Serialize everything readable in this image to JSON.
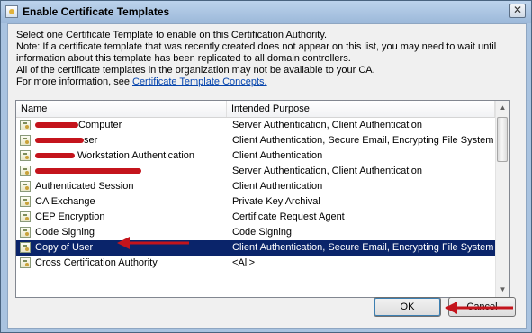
{
  "window": {
    "title": "Enable Certificate Templates",
    "close_glyph": "✕"
  },
  "info": {
    "line1": "Select one Certificate Template to enable on this Certification Authority.",
    "line2": "Note: If a certificate template that was recently created does not appear on this list, you may need to wait until",
    "line3": "information about this template has been replicated to all domain controllers.",
    "line4": "All of the certificate templates in the organization may not be available to your CA.",
    "line5_prefix": "For more information, see ",
    "line5_link": "Certificate Template Concepts."
  },
  "list": {
    "columns": {
      "name": "Name",
      "purpose": "Intended Purpose"
    },
    "rows": [
      {
        "name": "Computer",
        "purpose": "Server Authentication, Client Authentication"
      },
      {
        "name": "ser",
        "purpose": "Client Authentication, Secure Email, Encrypting File System"
      },
      {
        "name": "Workstation Authentication",
        "purpose": "Client Authentication"
      },
      {
        "name": "",
        "purpose": "Server Authentication, Client Authentication"
      },
      {
        "name": "Authenticated Session",
        "purpose": "Client Authentication"
      },
      {
        "name": "CA Exchange",
        "purpose": "Private Key Archival"
      },
      {
        "name": "CEP Encryption",
        "purpose": "Certificate Request Agent"
      },
      {
        "name": "Code Signing",
        "purpose": "Code Signing"
      },
      {
        "name": "Copy of User",
        "purpose": "Client Authentication, Secure Email, Encrypting File System"
      },
      {
        "name": "Cross Certification Authority",
        "purpose": "<All>"
      }
    ],
    "selected_index": 8
  },
  "buttons": {
    "ok": "OK",
    "cancel": "Cancel"
  },
  "colors": {
    "selection": "#0a246a",
    "redaction": "#c4141c",
    "annotation_arrow": "#c4141c",
    "link": "#0645ad"
  },
  "icons": {
    "app": "certificate-icon",
    "row": "certificate-template-icon",
    "close": "close-icon",
    "scroll_up": "chevron-up-icon",
    "scroll_down": "chevron-down-icon"
  }
}
